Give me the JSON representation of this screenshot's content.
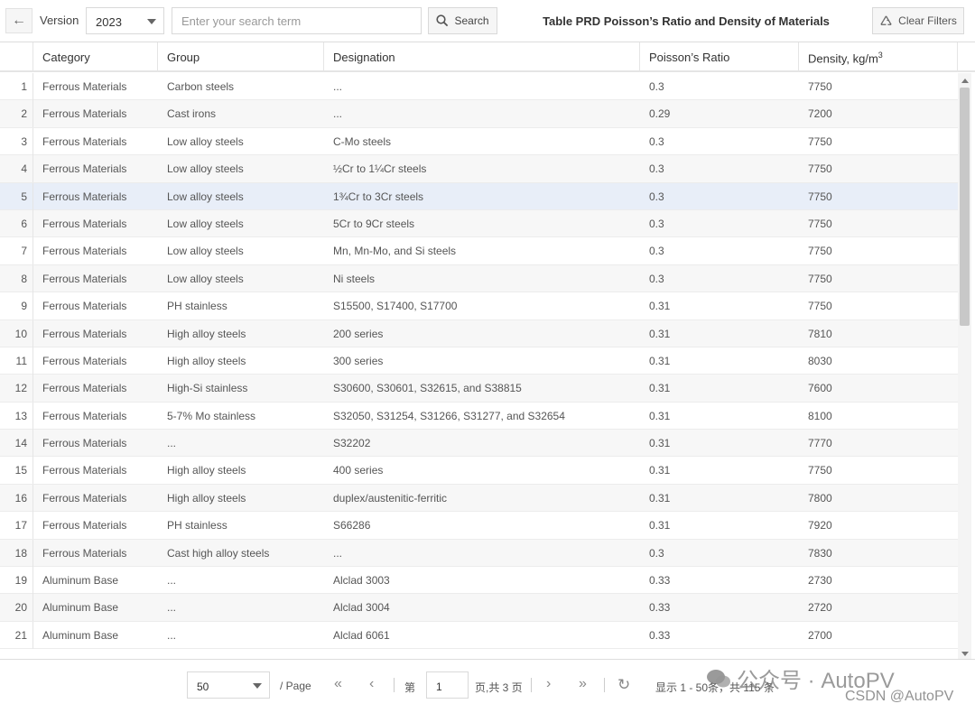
{
  "toolbar": {
    "version_label": "Version",
    "version_value": "2023",
    "search_placeholder": "Enter your search term",
    "search_label": "Search",
    "title": "Table PRD Poisson’s Ratio and Density of Materials",
    "clear_label": "Clear Filters"
  },
  "columns": [
    "Category",
    "Group",
    "Designation",
    "Poisson’s Ratio",
    "Density, kg/m",
    "3"
  ],
  "rows": [
    [
      "1",
      "Ferrous Materials",
      "Carbon steels",
      "...",
      "0.3",
      "7750"
    ],
    [
      "2",
      "Ferrous Materials",
      "Cast irons",
      "...",
      "0.29",
      "7200"
    ],
    [
      "3",
      "Ferrous Materials",
      "Low alloy steels",
      "C-Mo steels",
      "0.3",
      "7750"
    ],
    [
      "4",
      "Ferrous Materials",
      "Low alloy steels",
      "½Cr to 1¼Cr steels",
      "0.3",
      "7750"
    ],
    [
      "5",
      "Ferrous Materials",
      "Low alloy steels",
      "1¾Cr to 3Cr steels",
      "0.3",
      "7750"
    ],
    [
      "6",
      "Ferrous Materials",
      "Low alloy steels",
      "5Cr to 9Cr steels",
      "0.3",
      "7750"
    ],
    [
      "7",
      "Ferrous Materials",
      "Low alloy steels",
      "Mn, Mn-Mo, and Si steels",
      "0.3",
      "7750"
    ],
    [
      "8",
      "Ferrous Materials",
      "Low alloy steels",
      "Ni steels",
      "0.3",
      "7750"
    ],
    [
      "9",
      "Ferrous Materials",
      "PH stainless",
      "S15500, S17400, S17700",
      "0.31",
      "7750"
    ],
    [
      "10",
      "Ferrous Materials",
      "High alloy steels",
      "200 series",
      "0.31",
      "7810"
    ],
    [
      "11",
      "Ferrous Materials",
      "High alloy steels",
      "300 series",
      "0.31",
      "8030"
    ],
    [
      "12",
      "Ferrous Materials",
      "High-Si stainless",
      "S30600, S30601, S32615, and S38815",
      "0.31",
      "7600"
    ],
    [
      "13",
      "Ferrous Materials",
      "5-7% Mo stainless",
      "S32050, S31254, S31266, S31277, and S32654",
      "0.31",
      "8100"
    ],
    [
      "14",
      "Ferrous Materials",
      "...",
      "S32202",
      "0.31",
      "7770"
    ],
    [
      "15",
      "Ferrous Materials",
      "High alloy steels",
      "400 series",
      "0.31",
      "7750"
    ],
    [
      "16",
      "Ferrous Materials",
      "High alloy steels",
      "duplex/austenitic-ferritic",
      "0.31",
      "7800"
    ],
    [
      "17",
      "Ferrous Materials",
      "PH stainless",
      "S66286",
      "0.31",
      "7920"
    ],
    [
      "18",
      "Ferrous Materials",
      "Cast high alloy steels",
      "...",
      "0.3",
      "7830"
    ],
    [
      "19",
      "Aluminum Base",
      "...",
      "Alclad 3003",
      "0.33",
      "2730"
    ],
    [
      "20",
      "Aluminum Base",
      "...",
      "Alclad 3004",
      "0.33",
      "2720"
    ],
    [
      "21",
      "Aluminum Base",
      "...",
      "Alclad 6061",
      "0.33",
      "2700"
    ]
  ],
  "selected_row": 5,
  "pager": {
    "page_size": "50",
    "per_page": "/ Page",
    "di": "第",
    "current_page": "1",
    "total_pages": "页,共 3 页",
    "display": "显示 1 - 50条，共 115 条"
  },
  "watermark": {
    "line1": "公众号 · AutoPV",
    "line2": "CSDN @AutoPV"
  }
}
